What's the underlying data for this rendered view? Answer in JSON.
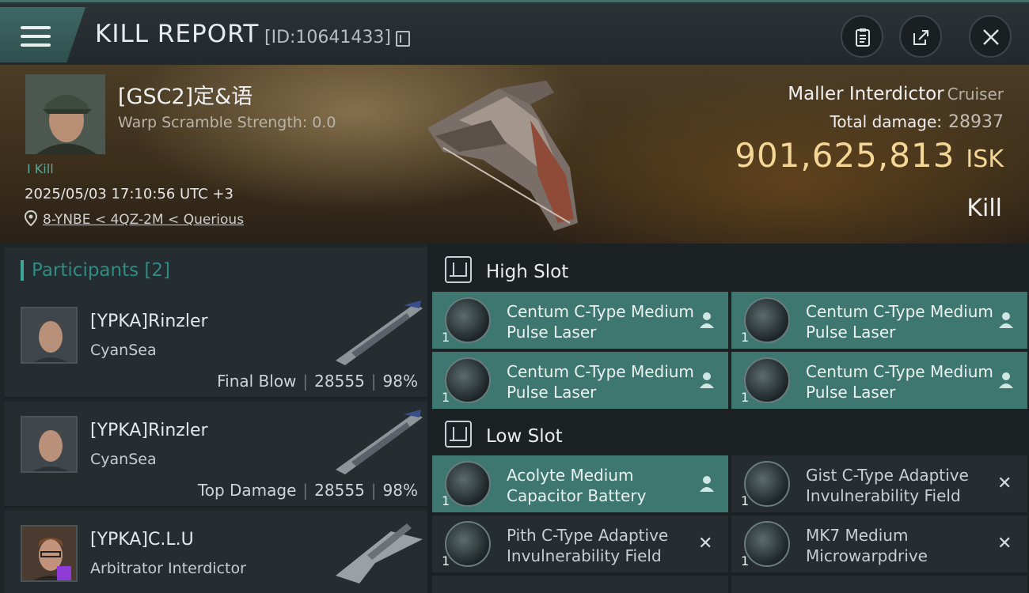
{
  "header": {
    "title": "KILL REPORT",
    "report_id": "[ID:10641433]"
  },
  "victim": {
    "name": "[GSC2]定&语",
    "warp_scramble": "Warp Scramble Strength: 0.0",
    "kill_count": "I Kill",
    "time": "2025/05/03 17:10:56 UTC +3",
    "location": "8-YNBE < 4QZ-2M < Querious",
    "ship_name": "Maller Interdictor",
    "ship_class": "Cruiser",
    "total_damage_label": "Total damage:",
    "total_damage": "28937",
    "isk_value": "901,625,813",
    "isk_unit": "ISK",
    "result": "Kill"
  },
  "participants": {
    "title": "Participants",
    "count": "[2]",
    "rows": [
      {
        "name": "[YPKA]Rinzler",
        "corp": "CyanSea",
        "role": "Final Blow",
        "damage": "28555",
        "percent": "98%"
      },
      {
        "name": "[YPKA]Rinzler",
        "corp": "CyanSea",
        "role": "Top Damage",
        "damage": "28555",
        "percent": "98%"
      },
      {
        "name": "[YPKA]C.L.U",
        "corp": "Arbitrator Interdictor"
      }
    ]
  },
  "fitting": {
    "high_slot_label": "High Slot",
    "low_slot_label": "Low Slot",
    "high": [
      {
        "name": "Centum C-Type Medium Pulse Laser",
        "qty": "1",
        "status": "fitted"
      },
      {
        "name": "Centum C-Type Medium Pulse Laser",
        "qty": "1",
        "status": "fitted"
      },
      {
        "name": "Centum C-Type Medium Pulse Laser",
        "qty": "1",
        "status": "fitted"
      },
      {
        "name": "Centum C-Type Medium Pulse Laser",
        "qty": "1",
        "status": "fitted"
      }
    ],
    "low": [
      {
        "name": "Acolyte Medium Capacitor Battery",
        "qty": "1",
        "status": "fitted"
      },
      {
        "name": "Gist C-Type Adaptive Invulnerability Field",
        "qty": "1",
        "status": "destroyed"
      },
      {
        "name": "Pith C-Type Adaptive Invulnerability Field",
        "qty": "1",
        "status": "destroyed"
      },
      {
        "name": "MK7 Medium Microwarpdrive",
        "qty": "1",
        "status": "destroyed"
      }
    ],
    "status_dropped_mark": "✕"
  },
  "colors": {
    "accent": "#3ea79a",
    "fitted_row": "#3d7770",
    "isk": "#f4d796"
  }
}
